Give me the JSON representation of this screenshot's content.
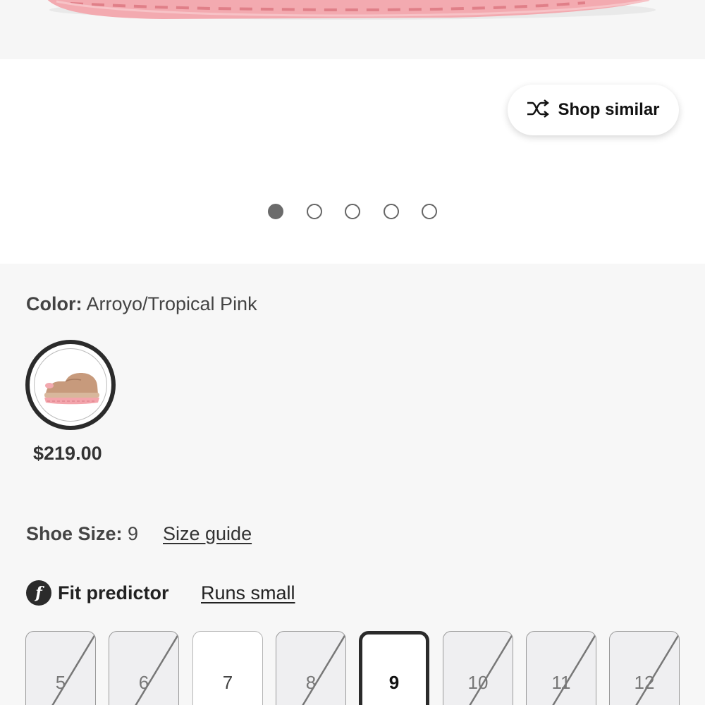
{
  "gallery": {
    "shop_similar_label": "Shop similar",
    "slide_count": 5,
    "active_slide": 1
  },
  "product": {
    "color_label": "Color:",
    "color_value": "Arroyo/Tropical Pink",
    "price": "$219.00"
  },
  "size": {
    "label": "Shoe Size:",
    "value": "9",
    "guide_link": "Size guide"
  },
  "fit": {
    "icon_glyph": "f",
    "label": "Fit predictor",
    "result": "Runs small"
  },
  "sizes": [
    {
      "label": "5",
      "state": "unavailable"
    },
    {
      "label": "6",
      "state": "unavailable"
    },
    {
      "label": "7",
      "state": "available"
    },
    {
      "label": "8",
      "state": "unavailable"
    },
    {
      "label": "9",
      "state": "selected"
    },
    {
      "label": "10",
      "state": "unavailable"
    },
    {
      "label": "11",
      "state": "unavailable"
    },
    {
      "label": "12",
      "state": "unavailable"
    }
  ],
  "colors": {
    "sole_pink": "#f1a0a6",
    "selected_border": "#2b2b2b",
    "unavailable_bg": "#efeff1"
  }
}
